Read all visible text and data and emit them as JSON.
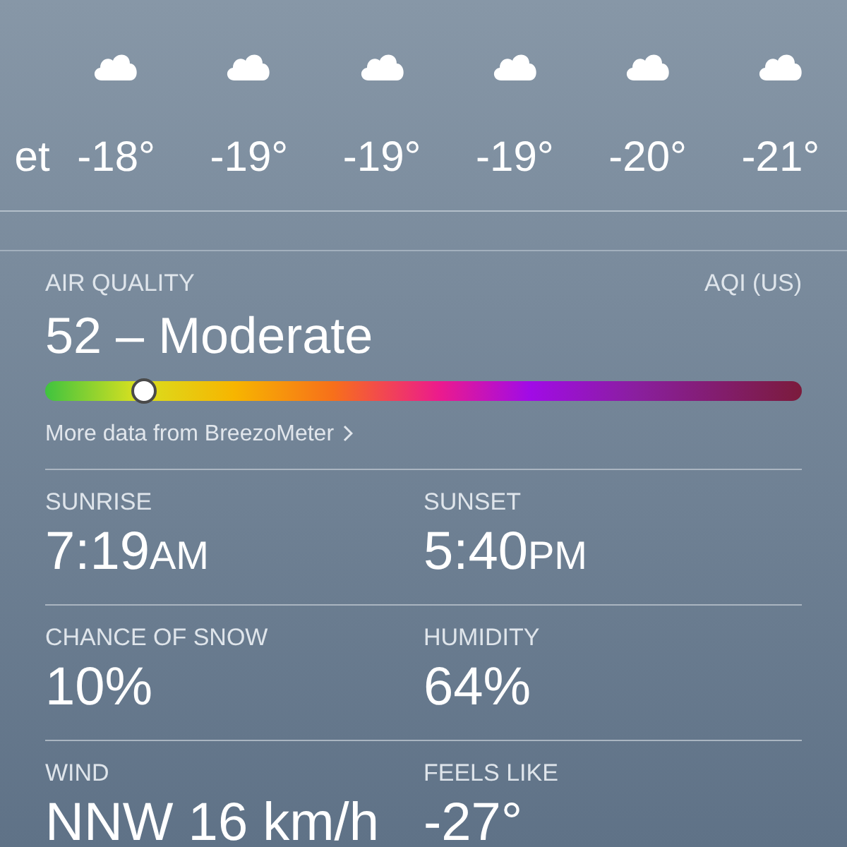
{
  "hourly": {
    "cut_label": "et",
    "items": [
      {
        "temp": "-18°"
      },
      {
        "temp": "-19°"
      },
      {
        "temp": "-19°"
      },
      {
        "temp": "-19°"
      },
      {
        "temp": "-20°"
      },
      {
        "temp": "-21°"
      }
    ]
  },
  "air_quality": {
    "title": "AIR QUALITY",
    "scale": "AQI (US)",
    "reading": "52 – Moderate",
    "level": 0.13,
    "link": "More data from BreezoMeter"
  },
  "details": [
    {
      "label": "SUNRISE",
      "value": "7:19",
      "suffix": "AM"
    },
    {
      "label": "SUNSET",
      "value": "5:40",
      "suffix": "PM"
    },
    {
      "label": "CHANCE OF SNOW",
      "value": "10%"
    },
    {
      "label": "HUMIDITY",
      "value": "64%"
    },
    {
      "label": "WIND",
      "value": "NNW 16 km/h"
    },
    {
      "label": "FEELS LIKE",
      "value": "-27°"
    }
  ]
}
